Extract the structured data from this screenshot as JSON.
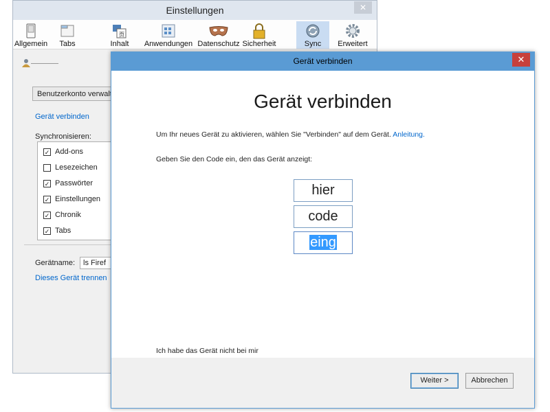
{
  "prefs": {
    "title": "Einstellungen",
    "close_glyph": "✕",
    "toolbar": [
      {
        "label": "Allgemein",
        "icon": "switch-icon"
      },
      {
        "label": "Tabs",
        "icon": "tabs-icon"
      },
      {
        "label": "Inhalt",
        "icon": "content-icon"
      },
      {
        "label": "Anwendungen",
        "icon": "applications-icon"
      },
      {
        "label": "Datenschutz",
        "icon": "mask-icon"
      },
      {
        "label": "Sicherheit",
        "icon": "padlock-icon"
      },
      {
        "label": "Sync",
        "icon": "sync-icon",
        "selected": true
      },
      {
        "label": "Erweitert",
        "icon": "gear-icon"
      }
    ],
    "account_button": "Benutzerkonto verwalt",
    "connect_link": "Gerät verbinden",
    "sync_label": "Synchronisieren:",
    "sync_items": [
      {
        "label": "Add-ons",
        "checked": true
      },
      {
        "label": "Lesezeichen",
        "checked": false
      },
      {
        "label": "Passwörter",
        "checked": true
      },
      {
        "label": "Einstellungen",
        "checked": true
      },
      {
        "label": "Chronik",
        "checked": true
      },
      {
        "label": "Tabs",
        "checked": true
      }
    ],
    "device_name_label": "Gerätname:",
    "device_name_value": "ls Firef",
    "disconnect_link": "Dieses Gerät trennen"
  },
  "dialog": {
    "title": "Gerät verbinden",
    "close_glyph": "✕",
    "heading": "Gerät verbinden",
    "instruction": "Um Ihr neues Gerät zu aktivieren, wählen Sie \"Verbinden\" auf dem Gerät.",
    "instruction_link": "Anleitung.",
    "code_prompt": "Geben Sie den Code ein, den das Gerät anzeigt:",
    "code_fields": [
      "hier",
      "code",
      "eing"
    ],
    "no_device_link": "Ich habe das Gerät nicht bei mir",
    "next_button": "Weiter >",
    "cancel_button": "Abbrechen"
  },
  "colors": {
    "accent": "#5a9bd4",
    "link": "#0066cc",
    "close_red": "#c7403b",
    "selection": "#3399ff"
  }
}
